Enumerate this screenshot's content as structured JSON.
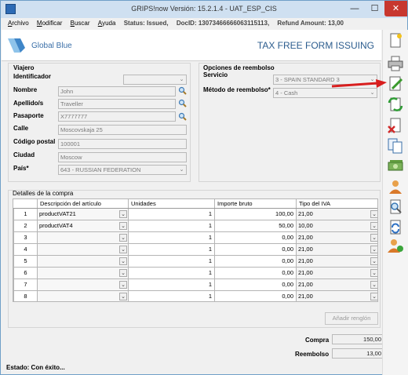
{
  "window": {
    "title": "GRIPS!now Versión: 15.2.1.4 - UAT_ESP_CIS",
    "min_label": "—",
    "max_label": "☐",
    "close_label": "✕"
  },
  "menu": {
    "archivo": "rchivo",
    "archivo_key": "A",
    "modificar": "odificar",
    "modificar_key": "M",
    "buscar": "uscar",
    "buscar_key": "B",
    "ayuda": "yuda",
    "ayuda_key": "A",
    "status": "Status: Issued,",
    "docid": "DocID: 13073466666063115113,",
    "refund": "Refund Amount: 13,00"
  },
  "header": {
    "logo_text": "Global Blue",
    "title": "TAX FREE FORM ISSUING"
  },
  "viajero": {
    "group_label": "Viajero",
    "identificador_label": "Identificador",
    "identificador_value": "",
    "nombre_label": "Nombre",
    "nombre_value": "John",
    "apellido_label": "Apellido/s",
    "apellido_value": "Traveller",
    "pasaporte_label": "Pasaporte",
    "pasaporte_value": "X7777777",
    "calle_label": "Calle",
    "calle_value": "Moscovskaja 25",
    "cp_label": "Código postal",
    "cp_value": "100001",
    "ciudad_label": "Ciudad",
    "ciudad_value": "Moscow",
    "pais_label": "País*",
    "pais_value": "643 - RUSSIAN FEDERATION"
  },
  "reembolso": {
    "group_label": "Opciones de reembolso",
    "servicio_label": "Servicio",
    "servicio_value": "3 - SPAIN STANDARD 3",
    "metodo_label": "Método de reembolso*",
    "metodo_value": "4 - Cash"
  },
  "compra": {
    "group_label": "Detalles de la compra",
    "columns": [
      "",
      "Descripción del artículo",
      "Unidades",
      "Importe bruto",
      "Tipo del IVA"
    ],
    "rows": [
      {
        "n": "1",
        "desc": "productVAT21",
        "units": "1",
        "amount": "100,00",
        "vat": "21,00"
      },
      {
        "n": "2",
        "desc": "productVAT4",
        "units": "1",
        "amount": "50,00",
        "vat": "10,00"
      },
      {
        "n": "3",
        "desc": "",
        "units": "1",
        "amount": "0,00",
        "vat": "21,00"
      },
      {
        "n": "4",
        "desc": "",
        "units": "1",
        "amount": "0,00",
        "vat": "21,00"
      },
      {
        "n": "5",
        "desc": "",
        "units": "1",
        "amount": "0,00",
        "vat": "21,00"
      },
      {
        "n": "6",
        "desc": "",
        "units": "1",
        "amount": "0,00",
        "vat": "21,00"
      },
      {
        "n": "7",
        "desc": "",
        "units": "1",
        "amount": "0,00",
        "vat": "21,00"
      },
      {
        "n": "8",
        "desc": "",
        "units": "1",
        "amount": "0,00",
        "vat": "21,00"
      }
    ],
    "add_row_label": "Añadir renglón"
  },
  "totals": {
    "compra_label": "Compra",
    "compra_value": "150,00",
    "reembolso_label": "Reembolso",
    "reembolso_value": "13,00"
  },
  "status_bar": {
    "text": "Estado:  Con éxito..."
  },
  "toolbar_icons": [
    "new-document-icon",
    "print-icon",
    "edit-document-icon",
    "refresh-document-icon",
    "delete-document-icon",
    "copy-documents-icon",
    "money-icon",
    "user-icon",
    "search-document-icon",
    "sync-document-icon",
    "user-add-icon"
  ],
  "colors": {
    "accent": "#2b5c8e",
    "close_button": "#c7372f",
    "arrow": "#d81e1e"
  }
}
